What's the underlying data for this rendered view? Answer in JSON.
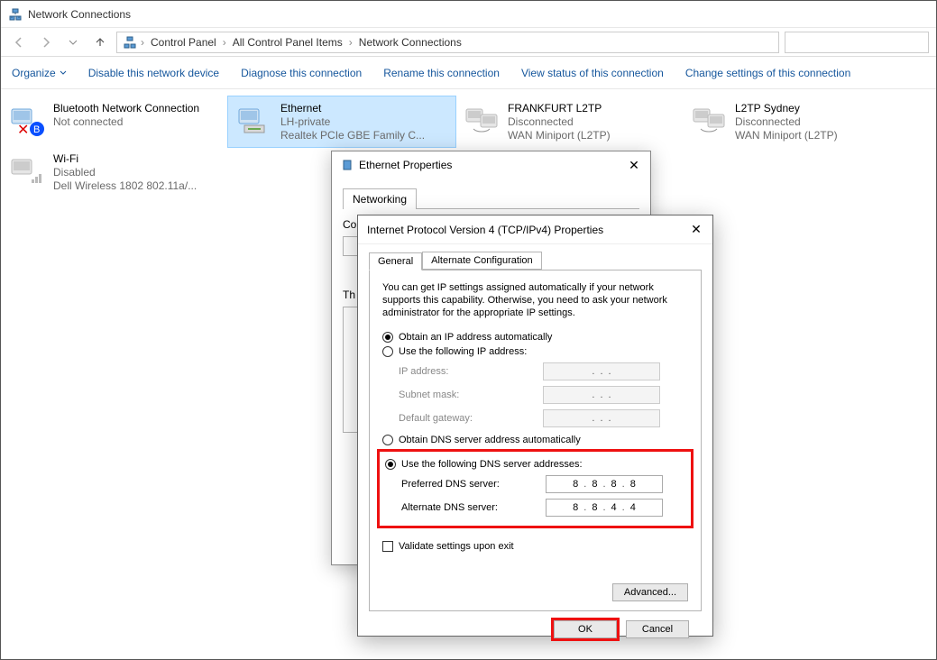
{
  "window_title": "Network Connections",
  "breadcrumbs": [
    "Control Panel",
    "All Control Panel Items",
    "Network Connections"
  ],
  "commands": {
    "organize": "Organize",
    "disable": "Disable this network device",
    "diagnose": "Diagnose this connection",
    "rename": "Rename this connection",
    "viewstatus": "View status of this connection",
    "changesettings": "Change settings of this connection"
  },
  "connections": [
    {
      "name": "Bluetooth Network Connection",
      "status": "Not connected",
      "device": ""
    },
    {
      "name": "Ethernet",
      "status": "LH-private",
      "device": "Realtek PCIe GBE Family C..."
    },
    {
      "name": "FRANKFURT L2TP",
      "status": "Disconnected",
      "device": "WAN Miniport (L2TP)"
    },
    {
      "name": "L2TP Sydney",
      "status": "Disconnected",
      "device": "WAN Miniport (L2TP)"
    },
    {
      "name": "Wi-Fi",
      "status": "Disabled",
      "device": "Dell Wireless 1802 802.11a/..."
    }
  ],
  "dlg1": {
    "title": "Ethernet Properties",
    "tab": "Networking",
    "connect_label": "Co",
    "this_label": "Th"
  },
  "dlg2": {
    "title": "Internet Protocol Version 4 (TCP/IPv4) Properties",
    "tabs": {
      "general": "General",
      "alt": "Alternate Configuration"
    },
    "intro": "You can get IP settings assigned automatically if your network supports this capability. Otherwise, you need to ask your network administrator for the appropriate IP settings.",
    "ip_auto": "Obtain an IP address automatically",
    "ip_manual": "Use the following IP address:",
    "ip_label": "IP address:",
    "subnet_label": "Subnet mask:",
    "gateway_label": "Default gateway:",
    "dns_auto": "Obtain DNS server address automatically",
    "dns_manual": "Use the following DNS server addresses:",
    "pref_dns_label": "Preferred DNS server:",
    "alt_dns_label": "Alternate DNS server:",
    "pref_dns": [
      "8",
      "8",
      "8",
      "8"
    ],
    "alt_dns": [
      "8",
      "8",
      "4",
      "4"
    ],
    "validate": "Validate settings upon exit",
    "advanced": "Advanced...",
    "ok": "OK",
    "cancel": "Cancel"
  }
}
